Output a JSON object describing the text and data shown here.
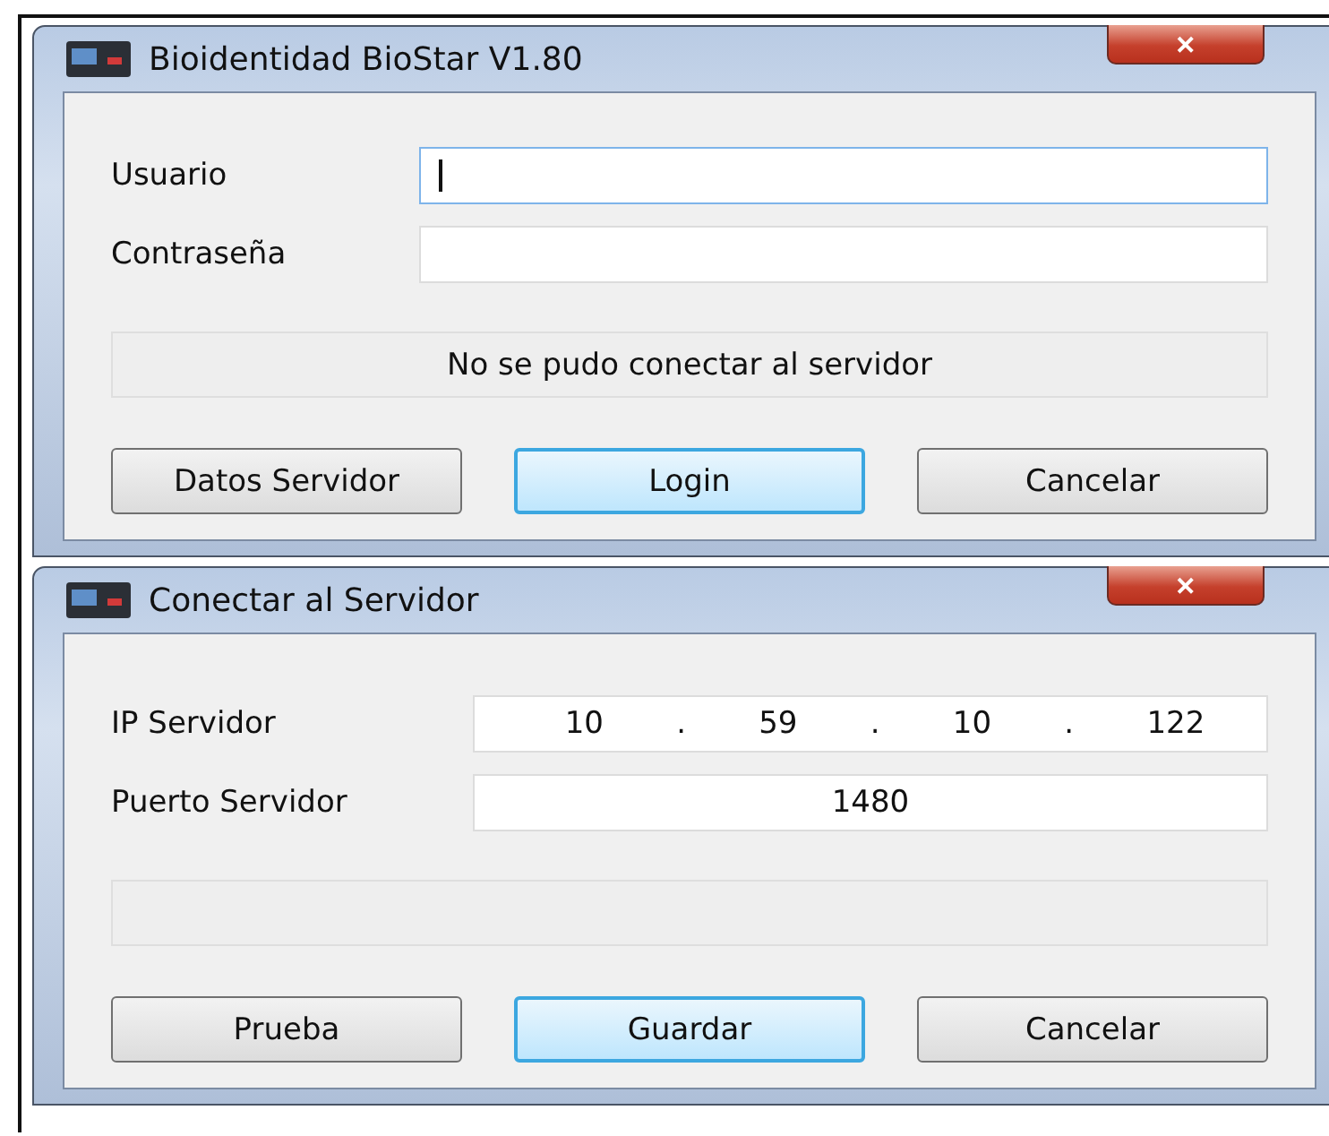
{
  "windows": [
    {
      "title": "Bioidentidad BioStar V1.80",
      "close": "✕",
      "fields": [
        {
          "kind": "text",
          "label": "Usuario",
          "focused": true
        },
        {
          "kind": "text",
          "label": "Contraseña"
        }
      ],
      "status": "No se pudo conectar al servidor",
      "buttons": [
        {
          "label": "Datos Servidor",
          "default": false
        },
        {
          "label": "Login",
          "default": true
        },
        {
          "label": "Cancelar",
          "default": false
        }
      ]
    },
    {
      "title": "Conectar al Servidor",
      "close": "✕",
      "fields": [
        {
          "kind": "ip",
          "label": "IP Servidor",
          "parts": [
            "10",
            ".",
            "59",
            ".",
            "10",
            ".",
            "122"
          ]
        },
        {
          "kind": "text",
          "label": "Puerto Servidor",
          "value": "1480"
        }
      ],
      "buttons": [
        {
          "label": "Prueba",
          "default": false
        },
        {
          "label": "Guardar",
          "default": true
        },
        {
          "label": "Cancelar",
          "default": false
        }
      ]
    }
  ]
}
